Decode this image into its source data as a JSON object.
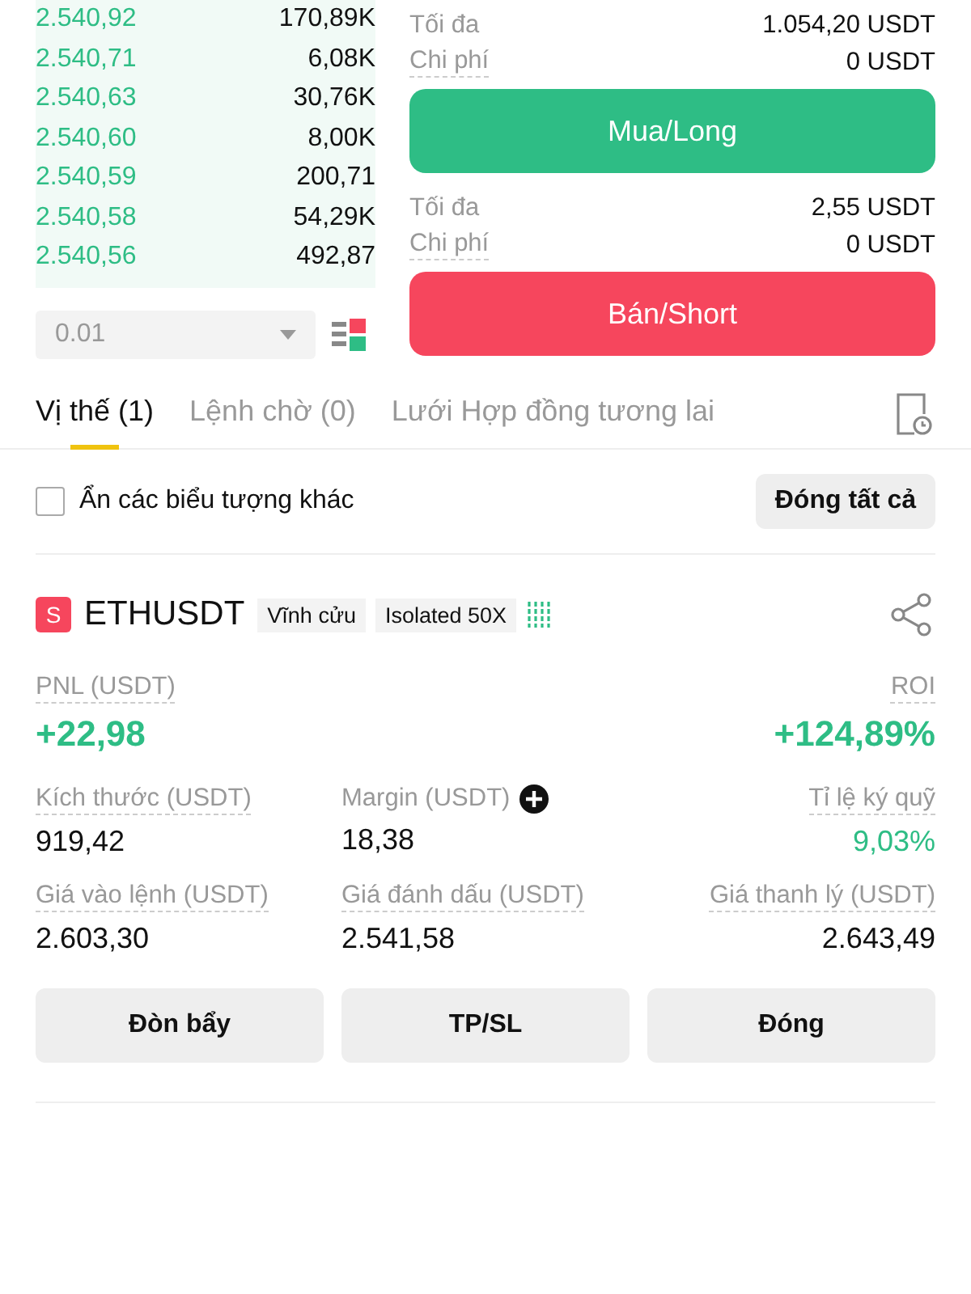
{
  "order_book": {
    "rows": [
      {
        "price": "2.540,92",
        "amount": "170,89K"
      },
      {
        "price": "2.540,71",
        "amount": "6,08K"
      },
      {
        "price": "2.540,63",
        "amount": "30,76K"
      },
      {
        "price": "2.540,60",
        "amount": "8,00K"
      },
      {
        "price": "2.540,59",
        "amount": "200,71"
      },
      {
        "price": "2.540,58",
        "amount": "54,29K"
      },
      {
        "price": "2.540,56",
        "amount": "492,87"
      }
    ],
    "precision": "0.01"
  },
  "orders": [
    {
      "kind": "buy",
      "max_label": "Tối đa",
      "max_value": "1.054,20 USDT",
      "cost_label": "Chi phí",
      "cost_value": "0 USDT",
      "button": "Mua/Long"
    },
    {
      "kind": "sell",
      "max_label": "Tối đa",
      "max_value": "2,55 USDT",
      "cost_label": "Chi phí",
      "cost_value": "0 USDT",
      "button": "Bán/Short"
    }
  ],
  "tabs": [
    {
      "label": "Vị thế (1)",
      "selected": true
    },
    {
      "label": "Lệnh chờ (0)",
      "selected": false
    },
    {
      "label": "Lưới Hợp đồng tương lai",
      "selected": false
    }
  ],
  "filter": {
    "label": "Ẩn các biểu tượng khác",
    "checked": false,
    "close_all": "Đóng tất cả"
  },
  "position": {
    "side": "S",
    "symbol": "ETHUSDT",
    "tags": [
      "Vĩnh cửu",
      "Isolated 50X"
    ],
    "pnl_label": "PNL (USDT)",
    "pnl": "+22,98",
    "roi_label": "ROI",
    "roi": "+124,89%",
    "stats": [
      {
        "label": "Kích thước (USDT)",
        "value": "919,42",
        "kind": "plain"
      },
      {
        "label": "Margin (USDT)",
        "value": "18,38",
        "kind": "add"
      },
      {
        "label": "Tỉ lệ ký quỹ",
        "value": "9,03%",
        "kind": "positive"
      },
      {
        "label": "Giá vào lệnh (USDT)",
        "value": "2.603,30",
        "kind": "plain"
      },
      {
        "label": "Giá đánh dấu (USDT)",
        "value": "2.541,58",
        "kind": "plain"
      },
      {
        "label": "Giá thanh lý (USDT)",
        "value": "2.643,49",
        "kind": "plain"
      }
    ],
    "actions": [
      "Đòn bẩy",
      "TP/SL",
      "Đóng"
    ]
  }
}
